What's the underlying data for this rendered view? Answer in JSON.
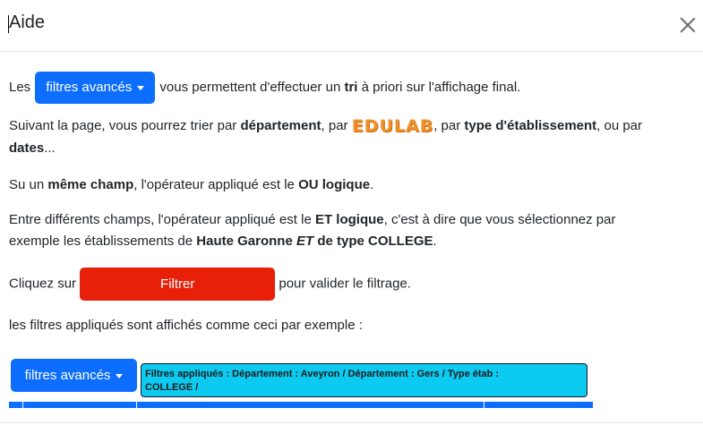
{
  "dialog": {
    "title": "Aide",
    "close_icon": "close-icon"
  },
  "p1": {
    "pre": "Les",
    "button": "filtres avancés",
    "mid": "vous permettent d'effectuer un",
    "bold": "tri",
    "post": "à priori sur l'affichage final."
  },
  "p2": {
    "pre": "Suivant la page, vous pourrez trier par",
    "b1": "département",
    "mid1": ", par",
    "logo": "EDULAB",
    "mid2": ", par",
    "b2": "type d'établissement",
    "mid3": ", ou par",
    "b3": "dates",
    "post": "..."
  },
  "p3": {
    "pre": "Su un",
    "b1": "même champ",
    "mid": ", l'opérateur appliqué est le",
    "b2": "OU logique",
    "post": "."
  },
  "p4": {
    "pre": "Entre différents champs, l'opérateur appliqué est le",
    "b1": "ET logique",
    "mid": ", c'est à dire que vous sélectionnez par",
    "line2_pre": "exemple les établissements de",
    "b2": "Haute Garonne",
    "i1": "ET",
    "b3": "de type COLLEGE",
    "post": "."
  },
  "p5": {
    "pre": "Cliquez sur",
    "button": "Filtrer",
    "post": "pour valider le filtrage."
  },
  "p6": {
    "text": "les filtres appliqués sont affichés comme ceci par exemple :"
  },
  "example": {
    "button": "filtres avancés",
    "applied_line1": "Filtres appliqués : Département : Aveyron / Département : Gers / Type étab :",
    "applied_line2": "COLLEGE /"
  },
  "colors": {
    "primary": "#0d6efd",
    "danger": "#e8200a",
    "info": "#0dcaf0",
    "logo": "#f0902b"
  }
}
